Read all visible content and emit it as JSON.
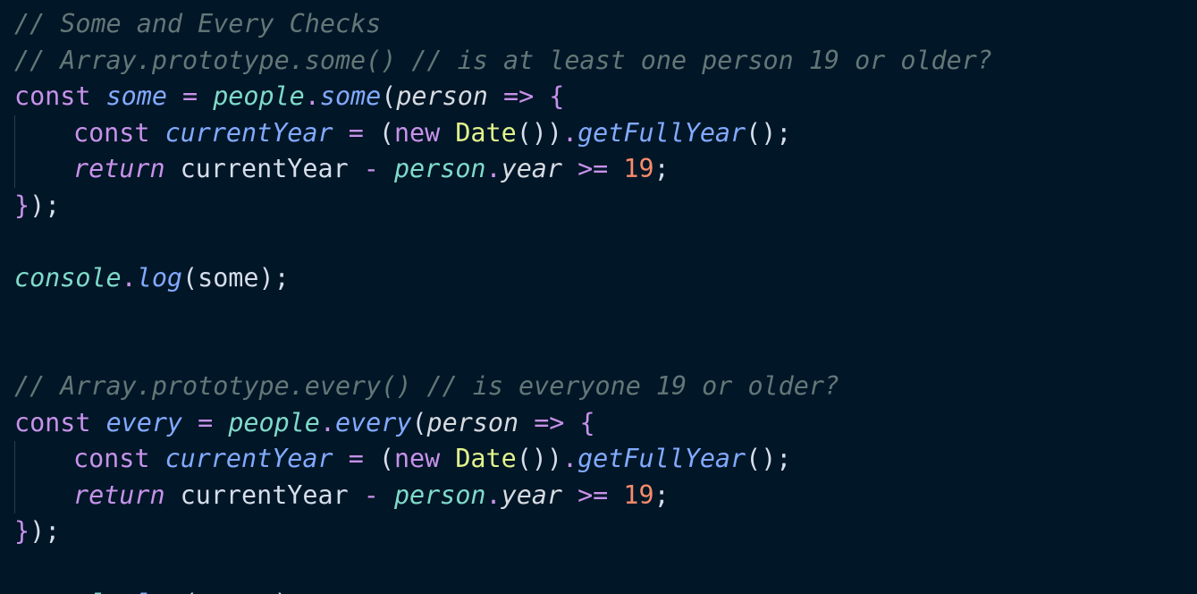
{
  "editor": {
    "lines": [
      [
        {
          "t": "// Some and Every Checks",
          "c": "c-comment"
        }
      ],
      [
        {
          "t": "// Array.prototype.some() // is at least one person 19 or older?",
          "c": "c-comment"
        }
      ],
      [
        {
          "t": "const",
          "c": "c-kw"
        },
        {
          "t": " ",
          "c": "c-plain"
        },
        {
          "t": "some",
          "c": "c-var"
        },
        {
          "t": " ",
          "c": "c-plain"
        },
        {
          "t": "=",
          "c": "c-op"
        },
        {
          "t": " ",
          "c": "c-plain"
        },
        {
          "t": "people",
          "c": "c-obj"
        },
        {
          "t": ".",
          "c": "c-dot"
        },
        {
          "t": "some",
          "c": "c-method"
        },
        {
          "t": "(",
          "c": "c-punct"
        },
        {
          "t": "person",
          "c": "c-param"
        },
        {
          "t": " ",
          "c": "c-plain"
        },
        {
          "t": "=>",
          "c": "c-op"
        },
        {
          "t": " ",
          "c": "c-plain"
        },
        {
          "t": "{",
          "c": "c-brace"
        }
      ],
      [
        {
          "indent": true
        },
        {
          "t": "const",
          "c": "c-kw"
        },
        {
          "t": " ",
          "c": "c-plain"
        },
        {
          "t": "currentYear",
          "c": "c-var"
        },
        {
          "t": " ",
          "c": "c-plain"
        },
        {
          "t": "=",
          "c": "c-op"
        },
        {
          "t": " ",
          "c": "c-plain"
        },
        {
          "t": "(",
          "c": "c-punct"
        },
        {
          "t": "new",
          "c": "c-kw"
        },
        {
          "t": " ",
          "c": "c-plain"
        },
        {
          "t": "Date",
          "c": "c-date"
        },
        {
          "t": "())",
          "c": "c-punct"
        },
        {
          "t": ".",
          "c": "c-dot"
        },
        {
          "t": "getFullYear",
          "c": "c-method"
        },
        {
          "t": "();",
          "c": "c-punct"
        }
      ],
      [
        {
          "indent": true
        },
        {
          "t": "return",
          "c": "c-ret"
        },
        {
          "t": " ",
          "c": "c-plain"
        },
        {
          "t": "currentYear",
          "c": "c-plain"
        },
        {
          "t": " ",
          "c": "c-plain"
        },
        {
          "t": "-",
          "c": "c-op"
        },
        {
          "t": " ",
          "c": "c-plain"
        },
        {
          "t": "person",
          "c": "c-obj"
        },
        {
          "t": ".",
          "c": "c-dot"
        },
        {
          "t": "year",
          "c": "c-param"
        },
        {
          "t": " ",
          "c": "c-plain"
        },
        {
          "t": ">=",
          "c": "c-op"
        },
        {
          "t": " ",
          "c": "c-plain"
        },
        {
          "t": "19",
          "c": "c-num"
        },
        {
          "t": ";",
          "c": "c-punct"
        }
      ],
      [
        {
          "t": "}",
          "c": "c-brace"
        },
        {
          "t": ");",
          "c": "c-punct"
        }
      ],
      [],
      [
        {
          "t": "console",
          "c": "c-obj"
        },
        {
          "t": ".",
          "c": "c-dot"
        },
        {
          "t": "log",
          "c": "c-method"
        },
        {
          "t": "(",
          "c": "c-punct"
        },
        {
          "t": "some",
          "c": "c-plain"
        },
        {
          "t": ");",
          "c": "c-punct"
        }
      ],
      [],
      [],
      [
        {
          "t": "// Array.prototype.every() // is everyone 19 or older?",
          "c": "c-comment"
        }
      ],
      [
        {
          "t": "const",
          "c": "c-kw"
        },
        {
          "t": " ",
          "c": "c-plain"
        },
        {
          "t": "every",
          "c": "c-var"
        },
        {
          "t": " ",
          "c": "c-plain"
        },
        {
          "t": "=",
          "c": "c-op"
        },
        {
          "t": " ",
          "c": "c-plain"
        },
        {
          "t": "people",
          "c": "c-obj"
        },
        {
          "t": ".",
          "c": "c-dot"
        },
        {
          "t": "every",
          "c": "c-method"
        },
        {
          "t": "(",
          "c": "c-punct"
        },
        {
          "t": "person",
          "c": "c-param"
        },
        {
          "t": " ",
          "c": "c-plain"
        },
        {
          "t": "=>",
          "c": "c-op"
        },
        {
          "t": " ",
          "c": "c-plain"
        },
        {
          "t": "{",
          "c": "c-brace"
        }
      ],
      [
        {
          "indent": true
        },
        {
          "t": "const",
          "c": "c-kw"
        },
        {
          "t": " ",
          "c": "c-plain"
        },
        {
          "t": "currentYear",
          "c": "c-var"
        },
        {
          "t": " ",
          "c": "c-plain"
        },
        {
          "t": "=",
          "c": "c-op"
        },
        {
          "t": " ",
          "c": "c-plain"
        },
        {
          "t": "(",
          "c": "c-punct"
        },
        {
          "t": "new",
          "c": "c-kw"
        },
        {
          "t": " ",
          "c": "c-plain"
        },
        {
          "t": "Date",
          "c": "c-date"
        },
        {
          "t": "())",
          "c": "c-punct"
        },
        {
          "t": ".",
          "c": "c-dot"
        },
        {
          "t": "getFullYear",
          "c": "c-method"
        },
        {
          "t": "();",
          "c": "c-punct"
        }
      ],
      [
        {
          "indent": true
        },
        {
          "t": "return",
          "c": "c-ret"
        },
        {
          "t": " ",
          "c": "c-plain"
        },
        {
          "t": "currentYear",
          "c": "c-plain"
        },
        {
          "t": " ",
          "c": "c-plain"
        },
        {
          "t": "-",
          "c": "c-op"
        },
        {
          "t": " ",
          "c": "c-plain"
        },
        {
          "t": "person",
          "c": "c-obj"
        },
        {
          "t": ".",
          "c": "c-dot"
        },
        {
          "t": "year",
          "c": "c-param"
        },
        {
          "t": " ",
          "c": "c-plain"
        },
        {
          "t": ">=",
          "c": "c-op"
        },
        {
          "t": " ",
          "c": "c-plain"
        },
        {
          "t": "19",
          "c": "c-num"
        },
        {
          "t": ";",
          "c": "c-punct"
        }
      ],
      [
        {
          "t": "}",
          "c": "c-brace"
        },
        {
          "t": ");",
          "c": "c-punct"
        }
      ],
      [],
      [
        {
          "t": "console",
          "c": "c-obj"
        },
        {
          "t": ".",
          "c": "c-dot"
        },
        {
          "t": "log",
          "c": "c-method"
        },
        {
          "t": "(",
          "c": "c-punct"
        },
        {
          "t": "every",
          "c": "c-plain"
        },
        {
          "t": ");",
          "c": "c-punct"
        }
      ]
    ]
  },
  "theme": {
    "background": "#011627",
    "comment": "#637777",
    "keyword": "#c792ea",
    "variable": "#82aaff",
    "object": "#7fdbca",
    "number": "#f78c6c",
    "class": "#e2f38a",
    "text": "#d6deeb"
  }
}
